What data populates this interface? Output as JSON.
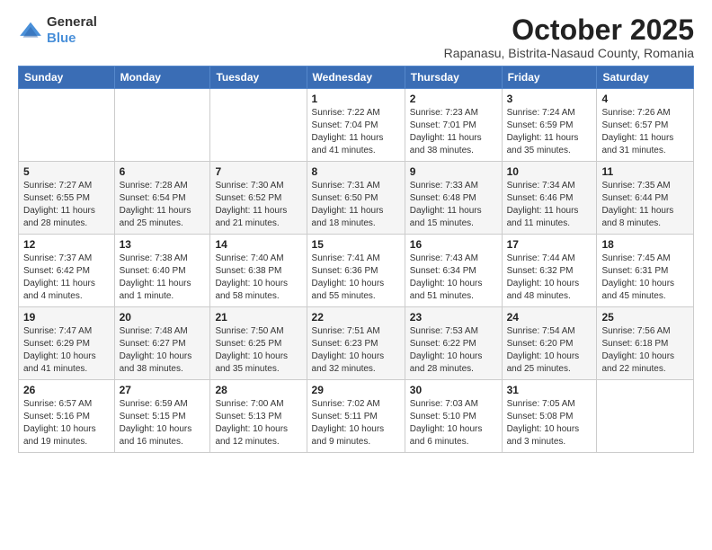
{
  "logo": {
    "general": "General",
    "blue": "Blue"
  },
  "title": "October 2025",
  "subtitle": "Rapanasu, Bistrita-Nasaud County, Romania",
  "headers": [
    "Sunday",
    "Monday",
    "Tuesday",
    "Wednesday",
    "Thursday",
    "Friday",
    "Saturday"
  ],
  "weeks": [
    [
      {
        "day": "",
        "info": ""
      },
      {
        "day": "",
        "info": ""
      },
      {
        "day": "",
        "info": ""
      },
      {
        "day": "1",
        "info": "Sunrise: 7:22 AM\nSunset: 7:04 PM\nDaylight: 11 hours and 41 minutes."
      },
      {
        "day": "2",
        "info": "Sunrise: 7:23 AM\nSunset: 7:01 PM\nDaylight: 11 hours and 38 minutes."
      },
      {
        "day": "3",
        "info": "Sunrise: 7:24 AM\nSunset: 6:59 PM\nDaylight: 11 hours and 35 minutes."
      },
      {
        "day": "4",
        "info": "Sunrise: 7:26 AM\nSunset: 6:57 PM\nDaylight: 11 hours and 31 minutes."
      }
    ],
    [
      {
        "day": "5",
        "info": "Sunrise: 7:27 AM\nSunset: 6:55 PM\nDaylight: 11 hours and 28 minutes."
      },
      {
        "day": "6",
        "info": "Sunrise: 7:28 AM\nSunset: 6:54 PM\nDaylight: 11 hours and 25 minutes."
      },
      {
        "day": "7",
        "info": "Sunrise: 7:30 AM\nSunset: 6:52 PM\nDaylight: 11 hours and 21 minutes."
      },
      {
        "day": "8",
        "info": "Sunrise: 7:31 AM\nSunset: 6:50 PM\nDaylight: 11 hours and 18 minutes."
      },
      {
        "day": "9",
        "info": "Sunrise: 7:33 AM\nSunset: 6:48 PM\nDaylight: 11 hours and 15 minutes."
      },
      {
        "day": "10",
        "info": "Sunrise: 7:34 AM\nSunset: 6:46 PM\nDaylight: 11 hours and 11 minutes."
      },
      {
        "day": "11",
        "info": "Sunrise: 7:35 AM\nSunset: 6:44 PM\nDaylight: 11 hours and 8 minutes."
      }
    ],
    [
      {
        "day": "12",
        "info": "Sunrise: 7:37 AM\nSunset: 6:42 PM\nDaylight: 11 hours and 4 minutes."
      },
      {
        "day": "13",
        "info": "Sunrise: 7:38 AM\nSunset: 6:40 PM\nDaylight: 11 hours and 1 minute."
      },
      {
        "day": "14",
        "info": "Sunrise: 7:40 AM\nSunset: 6:38 PM\nDaylight: 10 hours and 58 minutes."
      },
      {
        "day": "15",
        "info": "Sunrise: 7:41 AM\nSunset: 6:36 PM\nDaylight: 10 hours and 55 minutes."
      },
      {
        "day": "16",
        "info": "Sunrise: 7:43 AM\nSunset: 6:34 PM\nDaylight: 10 hours and 51 minutes."
      },
      {
        "day": "17",
        "info": "Sunrise: 7:44 AM\nSunset: 6:32 PM\nDaylight: 10 hours and 48 minutes."
      },
      {
        "day": "18",
        "info": "Sunrise: 7:45 AM\nSunset: 6:31 PM\nDaylight: 10 hours and 45 minutes."
      }
    ],
    [
      {
        "day": "19",
        "info": "Sunrise: 7:47 AM\nSunset: 6:29 PM\nDaylight: 10 hours and 41 minutes."
      },
      {
        "day": "20",
        "info": "Sunrise: 7:48 AM\nSunset: 6:27 PM\nDaylight: 10 hours and 38 minutes."
      },
      {
        "day": "21",
        "info": "Sunrise: 7:50 AM\nSunset: 6:25 PM\nDaylight: 10 hours and 35 minutes."
      },
      {
        "day": "22",
        "info": "Sunrise: 7:51 AM\nSunset: 6:23 PM\nDaylight: 10 hours and 32 minutes."
      },
      {
        "day": "23",
        "info": "Sunrise: 7:53 AM\nSunset: 6:22 PM\nDaylight: 10 hours and 28 minutes."
      },
      {
        "day": "24",
        "info": "Sunrise: 7:54 AM\nSunset: 6:20 PM\nDaylight: 10 hours and 25 minutes."
      },
      {
        "day": "25",
        "info": "Sunrise: 7:56 AM\nSunset: 6:18 PM\nDaylight: 10 hours and 22 minutes."
      }
    ],
    [
      {
        "day": "26",
        "info": "Sunrise: 6:57 AM\nSunset: 5:16 PM\nDaylight: 10 hours and 19 minutes."
      },
      {
        "day": "27",
        "info": "Sunrise: 6:59 AM\nSunset: 5:15 PM\nDaylight: 10 hours and 16 minutes."
      },
      {
        "day": "28",
        "info": "Sunrise: 7:00 AM\nSunset: 5:13 PM\nDaylight: 10 hours and 12 minutes."
      },
      {
        "day": "29",
        "info": "Sunrise: 7:02 AM\nSunset: 5:11 PM\nDaylight: 10 hours and 9 minutes."
      },
      {
        "day": "30",
        "info": "Sunrise: 7:03 AM\nSunset: 5:10 PM\nDaylight: 10 hours and 6 minutes."
      },
      {
        "day": "31",
        "info": "Sunrise: 7:05 AM\nSunset: 5:08 PM\nDaylight: 10 hours and 3 minutes."
      },
      {
        "day": "",
        "info": ""
      }
    ]
  ]
}
